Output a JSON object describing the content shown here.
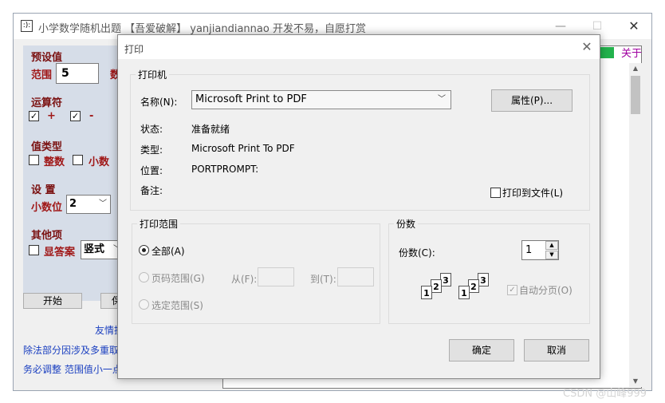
{
  "main_window": {
    "title": "小学数学随机出题 【吾爱破解】 yanjiandiannao 开发不易，自愿打赏",
    "app_icon": ":):",
    "min_icon": "—",
    "max_icon": "☐",
    "close_icon": "✕"
  },
  "presets": {
    "group_title": "预设值",
    "range_label": "范围",
    "range_value": "5",
    "count_label": "数"
  },
  "operators": {
    "group_title": "运算符",
    "plus_label": "+",
    "minus_label": "-",
    "plus_checked": true,
    "minus_checked": true
  },
  "value_type": {
    "group_title": "值类型",
    "integer_label": "整数",
    "decimal_label": "小数"
  },
  "settings": {
    "group_title": "设 置",
    "decimal_places_label": "小数位",
    "decimal_places_value": "2"
  },
  "other": {
    "group_title": "其他项",
    "show_answer_label": "显答案",
    "layout_value": "竖式"
  },
  "buttons": {
    "start": "开始",
    "save_partial": "保"
  },
  "notes": {
    "line1": "友情提",
    "line2": "除法部分因涉及多重取",
    "line3": "务必调整  范围值小一点"
  },
  "about_link": "关于",
  "colors": {
    "accent_green": "#22b24c",
    "label_red": "#a01818",
    "link_purple": "#a000a0",
    "note_blue": "#1a3fc0"
  },
  "print_dialog": {
    "title": "打印",
    "close_icon": "✕",
    "printer_group": "打印机",
    "name_label": "名称(N):",
    "printer_name": "Microsoft Print to PDF",
    "properties_button": "属性(P)...",
    "status_label": "状态:",
    "status_value": "准备就绪",
    "type_label": "类型:",
    "type_value": "Microsoft Print To PDF",
    "where_label": "位置:",
    "where_value": "PORTPROMPT:",
    "comment_label": "备注:",
    "print_to_file_label": "打印到文件(L)",
    "range_group": "打印范围",
    "all_label": "全部(A)",
    "pages_label": "页码范围(G)",
    "from_label": "从(F):",
    "to_label": "到(T):",
    "selection_label": "选定范围(S)",
    "copies_group": "份数",
    "copies_label": "份数(C):",
    "copies_value": "1",
    "collate_label": "自动分页(O)",
    "ok_button": "确定",
    "cancel_button": "取消"
  },
  "watermark": "CSDN @山峰999"
}
